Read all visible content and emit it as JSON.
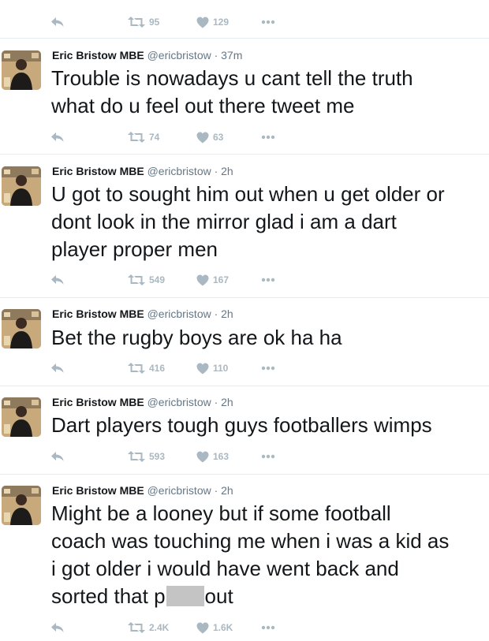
{
  "colors": {
    "text": "#14171a",
    "meta": "#657786",
    "action": "#aab8c2",
    "divider": "#e6ecf0"
  },
  "icons": {
    "reply": "reply-icon",
    "retweet": "retweet-icon",
    "like": "heart-icon",
    "more": "more-icon"
  },
  "top_partial": {
    "retweets": "95",
    "likes": "129"
  },
  "tweets": [
    {
      "name": "Eric Bristow MBE",
      "meta": "@ericbristow · 37m",
      "lines": [
        "Trouble is nowadays u cant tell the truth",
        "what do u feel out there tweet me"
      ],
      "retweets": "74",
      "likes": "63"
    },
    {
      "name": "Eric Bristow MBE",
      "meta": "@ericbristow · 2h",
      "lines": [
        "U got to sought him out when u get older or",
        "dont look in the mirror glad i am a dart",
        "player proper men"
      ],
      "retweets": "549",
      "likes": "167"
    },
    {
      "name": "Eric Bristow MBE",
      "meta": "@ericbristow · 2h",
      "lines": [
        "Bet the rugby boys are ok ha ha"
      ],
      "retweets": "416",
      "likes": "110"
    },
    {
      "name": "Eric Bristow MBE",
      "meta": "@ericbristow · 2h",
      "lines": [
        "Dart players tough guys footballers wimps"
      ],
      "retweets": "593",
      "likes": "163"
    },
    {
      "name": "Eric Bristow MBE",
      "meta": "@ericbristow · 2h",
      "lines": [
        "Might be a looney but if some football",
        "coach was touching me when i was a kid as",
        "i got older i would have went back and"
      ],
      "last_line_start": "sorted that p",
      "last_line_end": "out",
      "retweets": "2.4K",
      "likes": "1.6K"
    }
  ]
}
